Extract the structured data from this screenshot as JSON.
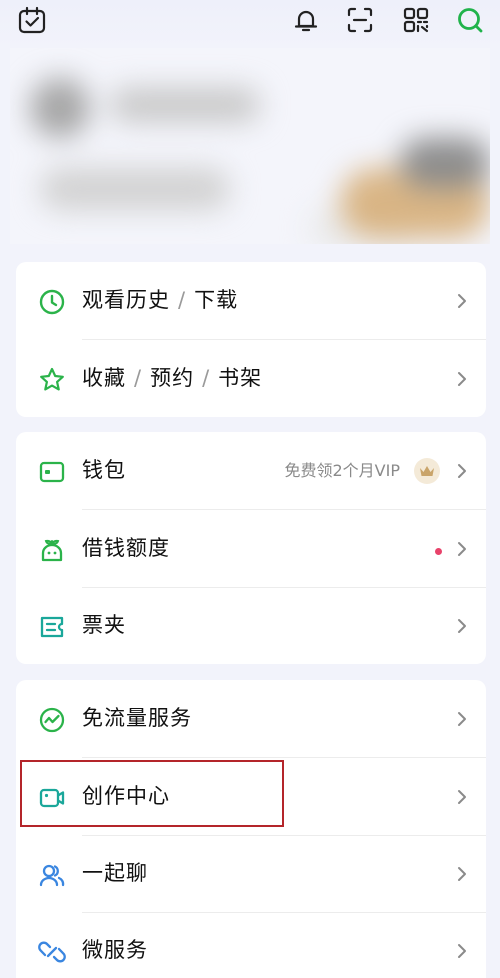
{
  "topbar": {
    "icons": [
      "calendar-check-icon",
      "bell-icon",
      "scan-icon",
      "qr-code-icon",
      "search-icon"
    ],
    "accent": "#21b34b"
  },
  "colors": {
    "icon_green": "#2bb34a",
    "icon_teal": "#1aa79a",
    "icon_blue": "#3a86e0",
    "chevron": "#8a8a8a",
    "red_dot": "#e8426a",
    "highlight": "#b4252a"
  },
  "section1": {
    "history": {
      "part1": "观看历史",
      "sep": "/",
      "part2": "下载"
    },
    "favorites": {
      "part1": "收藏",
      "sep1": "/",
      "part2": "预约",
      "sep2": "/",
      "part3": "书架"
    }
  },
  "section2": {
    "wallet": {
      "label": "钱包",
      "promo": "免费领2个月VIP"
    },
    "credit": {
      "label": "借钱额度"
    },
    "tickets": {
      "label": "票夹"
    }
  },
  "section3": {
    "free_data": {
      "label": "免流量服务"
    },
    "creator": {
      "label": "创作中心"
    },
    "chat": {
      "label": "一起聊"
    },
    "micro": {
      "label": "微服务"
    }
  }
}
